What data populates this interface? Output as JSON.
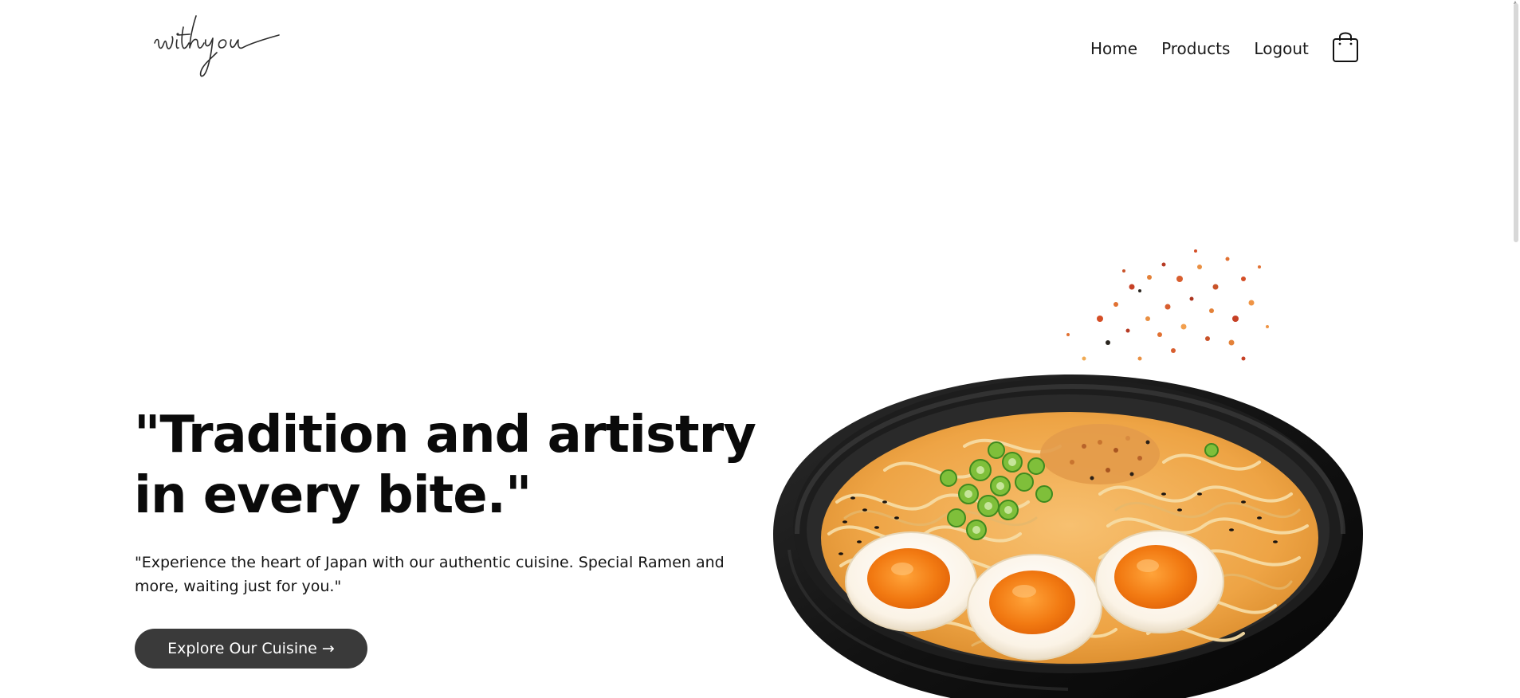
{
  "header": {
    "logo_text": "withyou",
    "nav": [
      {
        "label": "Home"
      },
      {
        "label": "Products"
      },
      {
        "label": "Logout"
      }
    ],
    "cart_icon": "shopping-bag-icon"
  },
  "hero": {
    "headline": "\"Tradition and artistry in every bite.\"",
    "subtext": "\"Experience the heart of Japan with our authentic cuisine. Special Ramen and more, waiting just for you.\"",
    "cta_label": "Explore Our Cuisine →",
    "image": "ramen-bowl-image"
  },
  "colors": {
    "button_bg": "#3a3a3a",
    "text": "#0a0a0a",
    "broth": "#f0a640",
    "yolk": "#f07f18",
    "bowl": "#1c1c1c"
  }
}
